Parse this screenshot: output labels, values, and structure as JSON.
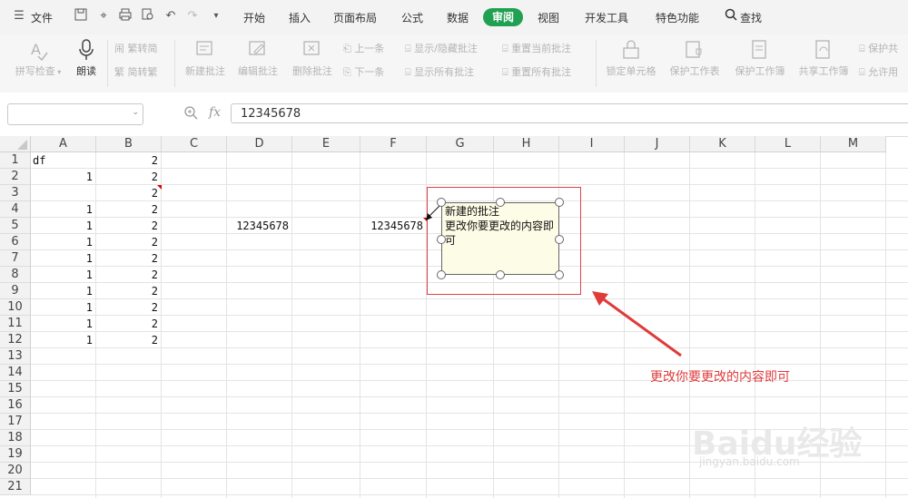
{
  "menubar": {
    "file_label": "文件",
    "tabs": [
      "开始",
      "插入",
      "页面布局",
      "公式",
      "数据",
      "审阅",
      "视图",
      "开发工具",
      "特色功能"
    ],
    "active_tab": "审阅",
    "search_label": "查找"
  },
  "ribbon": {
    "spell_check": "拼写检查",
    "read_aloud": "朗读",
    "trad_to_simp": "繁转简",
    "simp_to_trad": "简转繁",
    "new_comment": "新建批注",
    "edit_comment": "编辑批注",
    "delete_comment": "删除批注",
    "prev_item": "上一条",
    "next_item": "下一条",
    "show_hide_comment": "显示/隐藏批注",
    "show_all_comments": "显示所有批注",
    "reset_current_comment": "重置当前批注",
    "reset_all_comments": "重置所有批注",
    "lock_cell": "锁定单元格",
    "protect_sheet": "保护工作表",
    "protect_workbook": "保护工作簿",
    "share_workbook": "共享工作簿",
    "protect_share": "保护共",
    "allow_users": "允许用"
  },
  "formula_bar": {
    "name_box": "",
    "fx": "fx",
    "value": "12345678"
  },
  "columns": [
    "A",
    "B",
    "C",
    "D",
    "E",
    "F",
    "G",
    "H",
    "I",
    "J",
    "K",
    "L",
    "M"
  ],
  "rows": [
    "1",
    "2",
    "3",
    "4",
    "5",
    "6",
    "7",
    "8",
    "9",
    "10",
    "11",
    "12",
    "13",
    "14",
    "15",
    "16",
    "17",
    "18",
    "19",
    "20",
    "21"
  ],
  "cells": {
    "A1": "df",
    "B1": "2",
    "A2": "1",
    "B2": "2",
    "B3": "2",
    "A4": "1",
    "B4": "2",
    "A5": "1",
    "B5": "2",
    "D5": "12345678",
    "F5": "12345678",
    "A6": "1",
    "B6": "2",
    "A7": "1",
    "B7": "2",
    "A8": "1",
    "B8": "2",
    "A9": "1",
    "B9": "2",
    "A10": "1",
    "B10": "2",
    "A11": "1",
    "B11": "2",
    "A12": "1",
    "B12": "2"
  },
  "comment": {
    "line1": "新建的批注",
    "line2": "更改你要更改的内容即",
    "line3": "可"
  },
  "annotation": "更改你要更改的内容即可",
  "watermark": {
    "logo": "Baidu经验",
    "url": "jingyan.baidu.com"
  },
  "colors": {
    "active_tab": "#20a052",
    "annotation": "#e03a3a",
    "comment_bg": "#fdfce6"
  }
}
